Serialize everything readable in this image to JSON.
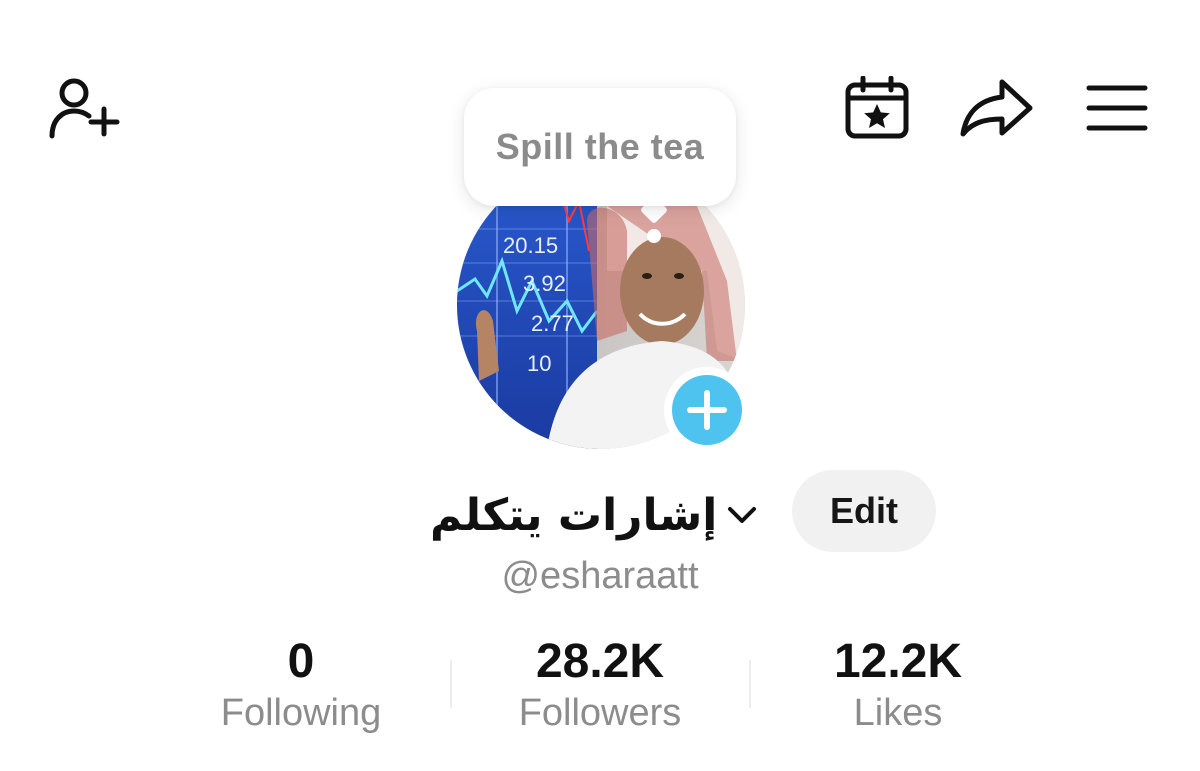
{
  "header": {
    "icons": {
      "add_friend": "add-friend-icon",
      "calendar": "calendar-star-icon",
      "share": "share-icon",
      "menu": "menu-icon"
    }
  },
  "tooltip": {
    "text": "Spill the tea"
  },
  "profile": {
    "avatar_ticker_values": [
      "20.15",
      "3.92",
      "2.77",
      "10"
    ],
    "display_name": "إشارات يتكلم",
    "handle": "@esharaatt",
    "edit_label": "Edit",
    "accent_color": "#4fc3ef"
  },
  "stats": [
    {
      "value": "0",
      "label": "Following"
    },
    {
      "value": "28.2K",
      "label": "Followers"
    },
    {
      "value": "12.2K",
      "label": "Likes"
    }
  ]
}
